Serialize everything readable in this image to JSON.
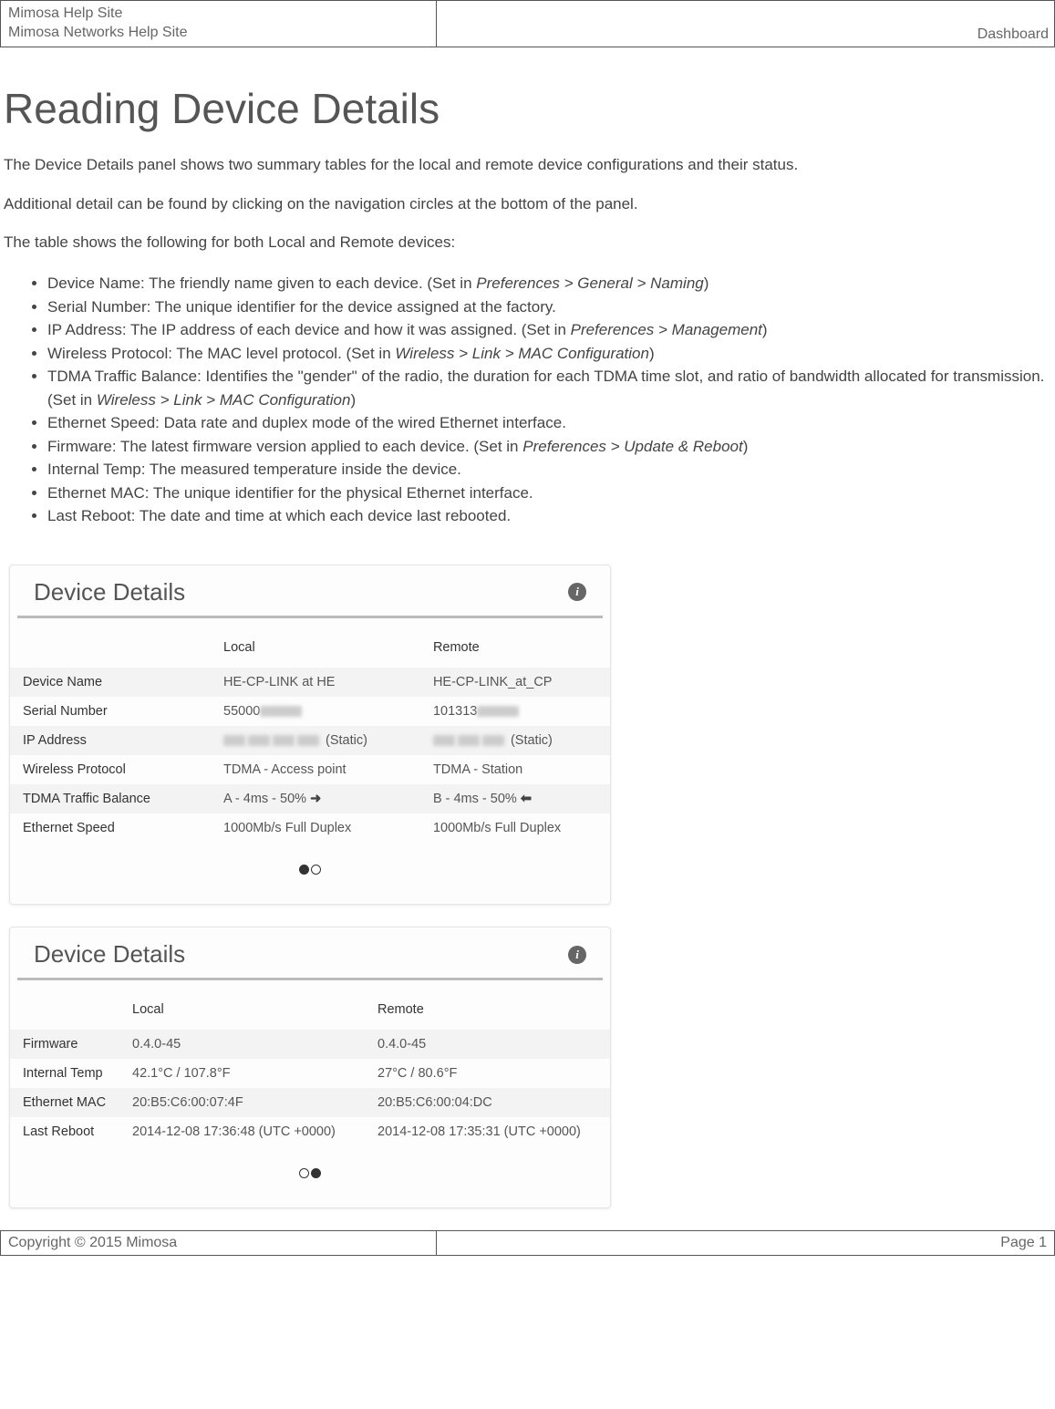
{
  "header": {
    "line1": "Mimosa Help Site",
    "line2": "Mimosa Networks Help Site",
    "right": "Dashboard"
  },
  "title": "Reading Device Details",
  "intro": [
    "The Device Details panel shows two summary tables for the local and remote device configurations and their status.",
    "Additional detail can be found by clicking on the navigation circles at the bottom of the panel.",
    "The table shows the following for both Local and Remote devices:"
  ],
  "fields": [
    {
      "term": "Device Name",
      "desc": "The friendly name given to each device. (Set in ",
      "path": "Preferences > General > Naming",
      "tail": ")"
    },
    {
      "term": "Serial Number",
      "desc": "The unique identifier for the device assigned at the factory.",
      "path": "",
      "tail": ""
    },
    {
      "term": "IP Address",
      "desc": "The IP address of each device and how it was assigned. (Set in ",
      "path": "Preferences > Management",
      "tail": ")"
    },
    {
      "term": "Wireless Protocol",
      "desc": "The MAC level protocol. (Set in ",
      "path": "Wireless > Link > MAC Configuration",
      "tail": ")"
    },
    {
      "term": "TDMA Traffic Balance",
      "desc": "Identifies the \"gender\" of the radio, the duration for each TDMA time slot, and ratio of bandwidth allocated for transmission. (Set in ",
      "path": "Wireless > Link > MAC Configuration",
      "tail": ")"
    },
    {
      "term": "Ethernet Speed",
      "desc": "Data rate and duplex mode of the wired Ethernet interface.",
      "path": "",
      "tail": ""
    },
    {
      "term": "Firmware",
      "desc": "The latest firmware version applied to each device. (Set in ",
      "path": "Preferences > Update & Reboot",
      "tail": ")"
    },
    {
      "term": "Internal Temp",
      "desc": "The measured temperature inside the device.",
      "path": "",
      "tail": ""
    },
    {
      "term": "Ethernet MAC",
      "desc": "The unique identifier for the physical Ethernet interface.",
      "path": "",
      "tail": ""
    },
    {
      "term": "Last Reboot",
      "desc": "The date and time at which each device last rebooted.",
      "path": "",
      "tail": ""
    }
  ],
  "panel1": {
    "title": "Device Details",
    "cols": [
      "",
      "Local",
      "Remote"
    ],
    "rows": [
      {
        "label": "Device Name",
        "local": "HE-CP-LINK at HE",
        "remote": "HE-CP-LINK_at_CP"
      },
      {
        "label": "Serial Number",
        "local": "55000",
        "remote": "101313",
        "blurLocal": true,
        "blurRemote": true
      },
      {
        "label": "IP Address",
        "local": "",
        "localSuffix": " (Static)",
        "remote": "",
        "remoteSuffix": " (Static)",
        "ipBlur": true
      },
      {
        "label": "Wireless Protocol",
        "local": "TDMA - Access point",
        "remote": "TDMA - Station"
      },
      {
        "label": "TDMA Traffic Balance",
        "local": "A - 4ms - 50%  ",
        "localArrow": "➜",
        "remote": "B - 4ms - 50%  ",
        "remoteArrow": "⬅"
      },
      {
        "label": "Ethernet Speed",
        "local": "1000Mb/s Full Duplex",
        "remote": "1000Mb/s Full Duplex"
      }
    ],
    "pagerActive": 0
  },
  "panel2": {
    "title": "Device Details",
    "cols": [
      "",
      "Local",
      "Remote"
    ],
    "rows": [
      {
        "label": "Firmware",
        "local": "0.4.0-45",
        "remote": "0.4.0-45"
      },
      {
        "label": "Internal Temp",
        "local": "42.1°C / 107.8°F",
        "remote": "27°C / 80.6°F"
      },
      {
        "label": "Ethernet MAC",
        "local": "20:B5:C6:00:07:4F",
        "remote": "20:B5:C6:00:04:DC"
      },
      {
        "label": "Last Reboot",
        "local": "2014-12-08 17:36:48 (UTC +0000)",
        "remote": "2014-12-08 17:35:31 (UTC +0000)"
      }
    ],
    "pagerActive": 1
  },
  "footer": {
    "left": "Copyright © 2015 Mimosa",
    "right": "Page 1"
  }
}
